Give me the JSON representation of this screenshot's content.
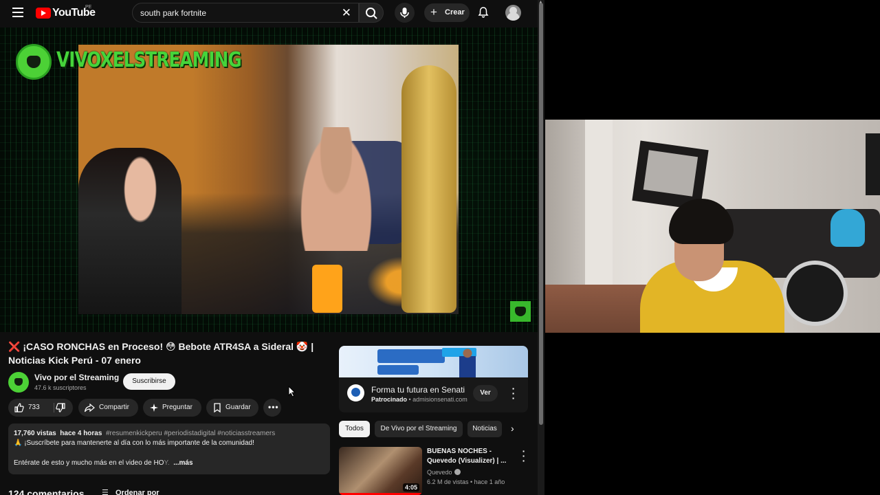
{
  "header": {
    "logo_text": "YouTube",
    "region": "PE",
    "search_query": "south park fortnite",
    "create_label": "Crear"
  },
  "player": {
    "brand_overlay": "VIVOXELSTREAMING"
  },
  "video": {
    "title_prefix": "❌",
    "title": " ¡CASO RONCHAS en Proceso! 😳 Bebote ATR4SA a Sideral 🤡 | Noticias Kick Perú - 07 enero",
    "channel_name": "Vivo por el Streaming",
    "subscribers": "47.6 k suscriptores",
    "subscribe_label": "Suscribirse",
    "likes": "733",
    "share_label": "Compartir",
    "ask_label": "Preguntar",
    "save_label": "Guardar",
    "more_label": "•••"
  },
  "description": {
    "views": "17,760 vistas",
    "time_ago": "hace 4 horas",
    "tags": "#resumenkickperu #periodistadigital #noticiasstreamers",
    "line1": "🙏 ¡Suscríbete para mantenerte al día con lo más importante de la comunidad!",
    "line2": "Entérate de esto y mucho más en el video de HO",
    "line2_fade": "Y.",
    "more_link": "...más"
  },
  "comments": {
    "count_label": "124 comentarios",
    "sort_label": "Ordenar por"
  },
  "ad": {
    "title": "Forma tu futura en Senati",
    "sponsored_label": "Patrocinado",
    "domain": "admisionsenati.com",
    "cta_label": "Ver"
  },
  "chips": [
    {
      "label": "Todos"
    },
    {
      "label": "De Vivo por el Streaming"
    },
    {
      "label": "Noticias"
    }
  ],
  "recommendation": {
    "title": "BUENAS NOCHES - Quevedo (Visualizer) | ...",
    "channel": "Quevedo",
    "meta": "6.2 M de vistas  •  hace 1 año",
    "duration": "4:05"
  },
  "colors": {
    "youtube_red": "#ff0000",
    "brand_green": "#45d43a",
    "bg_dark": "#0f0f0f",
    "chip_bg": "#272727"
  },
  "icons": {
    "menu": "hamburger-icon",
    "search": "search-icon",
    "clear": "close-icon",
    "mic": "microphone-icon",
    "create": "plus-icon",
    "notifications": "bell-icon",
    "like": "thumbs-up-icon",
    "dislike": "thumbs-down-icon",
    "share": "share-arrow-icon",
    "ask": "sparkle-icon",
    "save": "bookmark-icon",
    "more": "more-horizontal-icon",
    "sort": "sort-icon",
    "next": "chevron-right-icon"
  }
}
